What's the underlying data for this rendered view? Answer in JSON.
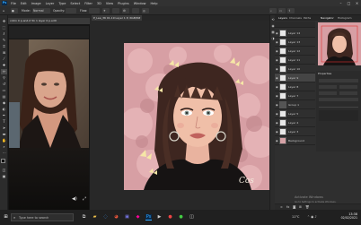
{
  "app": {
    "logo": "Ps",
    "menu": [
      "File",
      "Edit",
      "Image",
      "Layer",
      "Type",
      "Select",
      "Filter",
      "3D",
      "View",
      "Plugins",
      "Window",
      "Help"
    ]
  },
  "options_bar": {
    "items": [
      "Mode:",
      "Normal",
      "Opacity:",
      "Flow:"
    ]
  },
  "document": {
    "tab_label": "P_Lee_36 01-19 Layer 1 P, RGB/8#"
  },
  "reference_window": {
    "title": "collin 0 p-and-it 5k 1 layer 0 p.edit"
  },
  "panels": {
    "tabs": [
      "Layers",
      "Channels",
      "Paths"
    ],
    "nav_tabs": [
      "Navigator",
      "Histogram"
    ],
    "properties_title": "Properties",
    "layers": [
      {
        "name": "Layer 14"
      },
      {
        "name": "Layer 13"
      },
      {
        "name": "Layer 12"
      },
      {
        "name": "Layer 11"
      },
      {
        "name": "Layer 10"
      },
      {
        "name": "Layer 9"
      },
      {
        "name": "Layer 8"
      },
      {
        "name": "Layer 7"
      },
      {
        "name": "Group 1"
      },
      {
        "name": "Layer 5"
      },
      {
        "name": "Layer 4"
      },
      {
        "name": "Layer 3"
      },
      {
        "name": "Background"
      }
    ]
  },
  "art": {
    "signature": "Cos"
  },
  "windows": {
    "activate_line1": "Activate Windows",
    "activate_line2": "Go to Settings to activate Windows."
  },
  "taskbar": {
    "search_placeholder": "Type here to search",
    "weather": "11°C",
    "time": "13:38",
    "date": "02/02/2021"
  }
}
